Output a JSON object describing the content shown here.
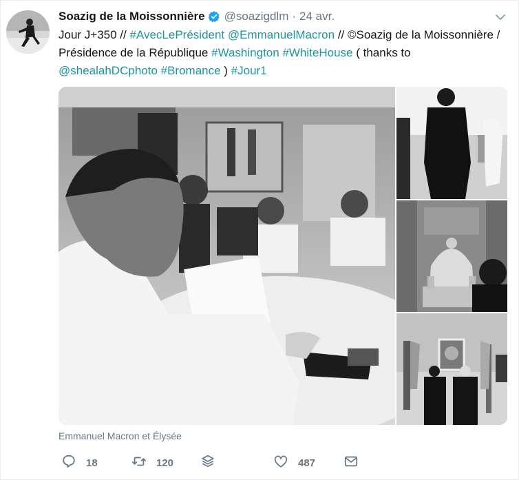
{
  "tweet": {
    "name": "Soazig de la Moissonnière",
    "handle": "@soazigdlm",
    "separator": "·",
    "time": "24 avr.",
    "text_parts": {
      "p1": "Jour J+350 // ",
      "p2": "#AvecLePrésident",
      "p3": " ",
      "p4": "@EmmanuelMacron",
      "p5": " // ©Soazig de la Moissonnière / Présidence de la République ",
      "p6": "#Washington",
      "p7": " ",
      "p8": "#WhiteHouse",
      "p9": " ( thanks to ",
      "p10": "@shealahDCphoto",
      "p11": " ",
      "p12": "#Bromance",
      "p13": " ) ",
      "p14": "#Jour1"
    },
    "caption": "Emmanuel Macron et Élysée",
    "counts": {
      "replies": "18",
      "retweets": "120",
      "likes": "487"
    }
  },
  "icons": {
    "verified": "verified-badge-icon",
    "caret": "chevron-down-icon",
    "reply": "reply-bubble-icon",
    "retweet": "retweet-icon",
    "stack": "layers-stack-icon",
    "like": "heart-icon",
    "message": "envelope-icon"
  },
  "colors": {
    "link": "#1b95a0",
    "verified": "#1da1f2",
    "muted": "#657786",
    "text": "#14171a"
  }
}
